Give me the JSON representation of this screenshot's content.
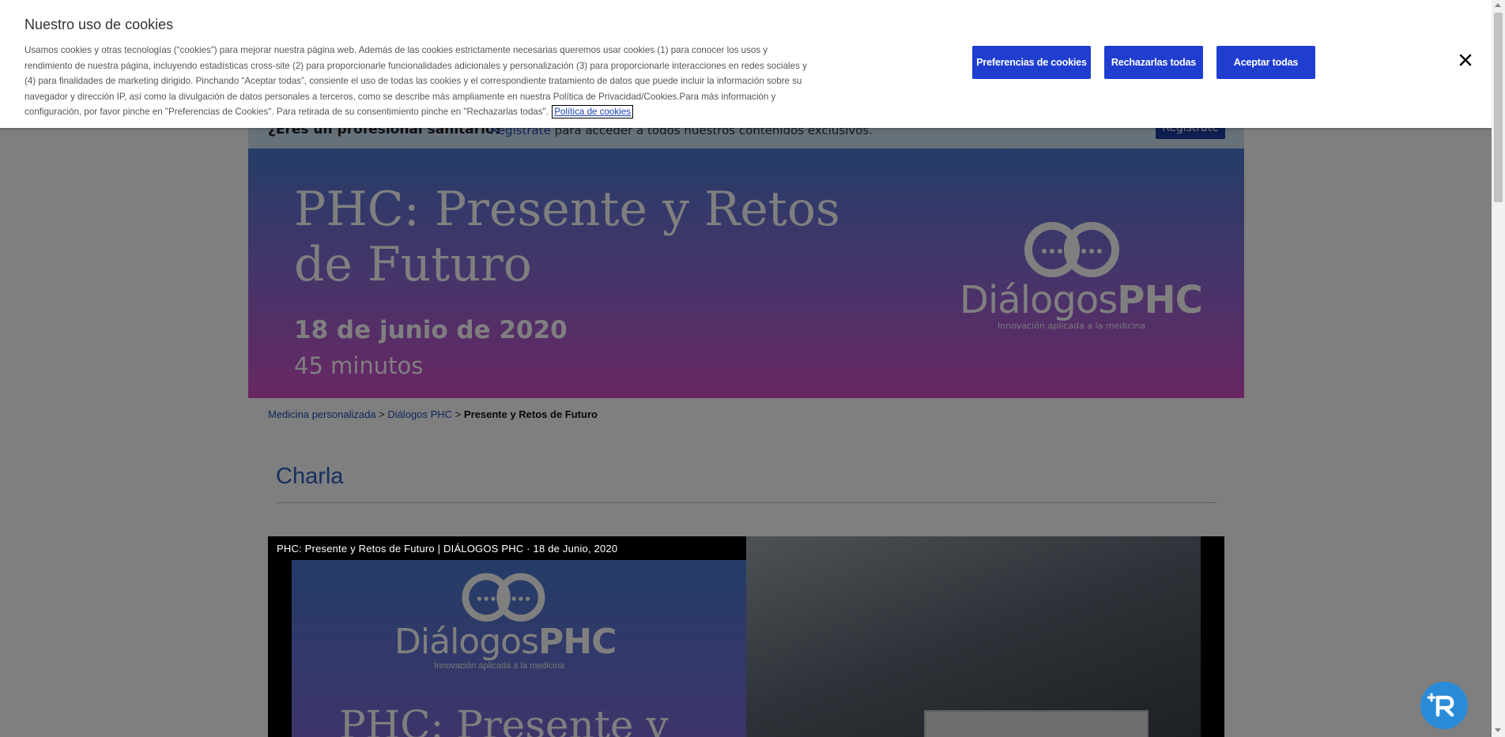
{
  "cookie_banner": {
    "title": "Nuestro uso de cookies",
    "body": "Usamos cookies y otras tecnologías (“cookies”) para mejorar nuestra página web. Además de las cookies estrictamente necesarias queremos usar cookies (1) para conocer los usos y rendimiento de nuestra página, incluyendo estadísticas cross-site (2) para proporcionarle funcionalidades adicionales y personalización (3) para proporcionarle interacciones en redes sociales y (4) para finalidades de marketing dirigido. Pinchando “Aceptar todas”, consiente el uso de todas las cookies y el correspondiente tratamiento de datos que puede incluir la información sobre su navegador y dirección IP, así como la divulgación de datos personales a terceros, como se describe más ampliamente en nuestra Política de Privacidad/Cookies.Para más información y configuración, por favor pinche en \"Preferencias de Cookies\". Para retirada de su consentimiento pinche en \"Rechazarlas todas\".",
    "policy_link": "Política de cookies",
    "buttons": {
      "preferences": "Preferencias de cookies",
      "reject_all": "Rechazarlas todas",
      "accept_all": "Aceptar todas"
    },
    "close_icon": "close-icon"
  },
  "pro_bar": {
    "question": "¿Eres un profesional sanitario?",
    "link": "Regístrate",
    "text": " para acceder a todos nuestros contenidos exclusivos.",
    "button": "Regístrate"
  },
  "hero": {
    "title": "PHC: Presente y Retos de Futuro",
    "date": "18 de junio de 2020",
    "duration": "45 minutos",
    "logo_word_light": "Diálogos",
    "logo_word_bold": "PHC",
    "logo_tagline": "Innovación aplicada a la medicina"
  },
  "breadcrumb": {
    "item1": "Medicina personalizada",
    "sep": " > ",
    "item2": "Diálogos PHC",
    "current": "Presente y Retos de Futuro"
  },
  "section": {
    "title": "Charla"
  },
  "video": {
    "title": "PHC: Presente y Retos de Futuro | DIÁLOGOS PHC · 18 de Junio, 2020",
    "logo_word_light": "Diálogos",
    "logo_word_bold": "PHC",
    "logo_tagline": "Innovación aplicada a la medicina",
    "big_text": "PHC: Presente y"
  },
  "colors": {
    "accent": "#1f3ed0",
    "link": "#1f4fb4",
    "fab": "#2a8bd8"
  }
}
